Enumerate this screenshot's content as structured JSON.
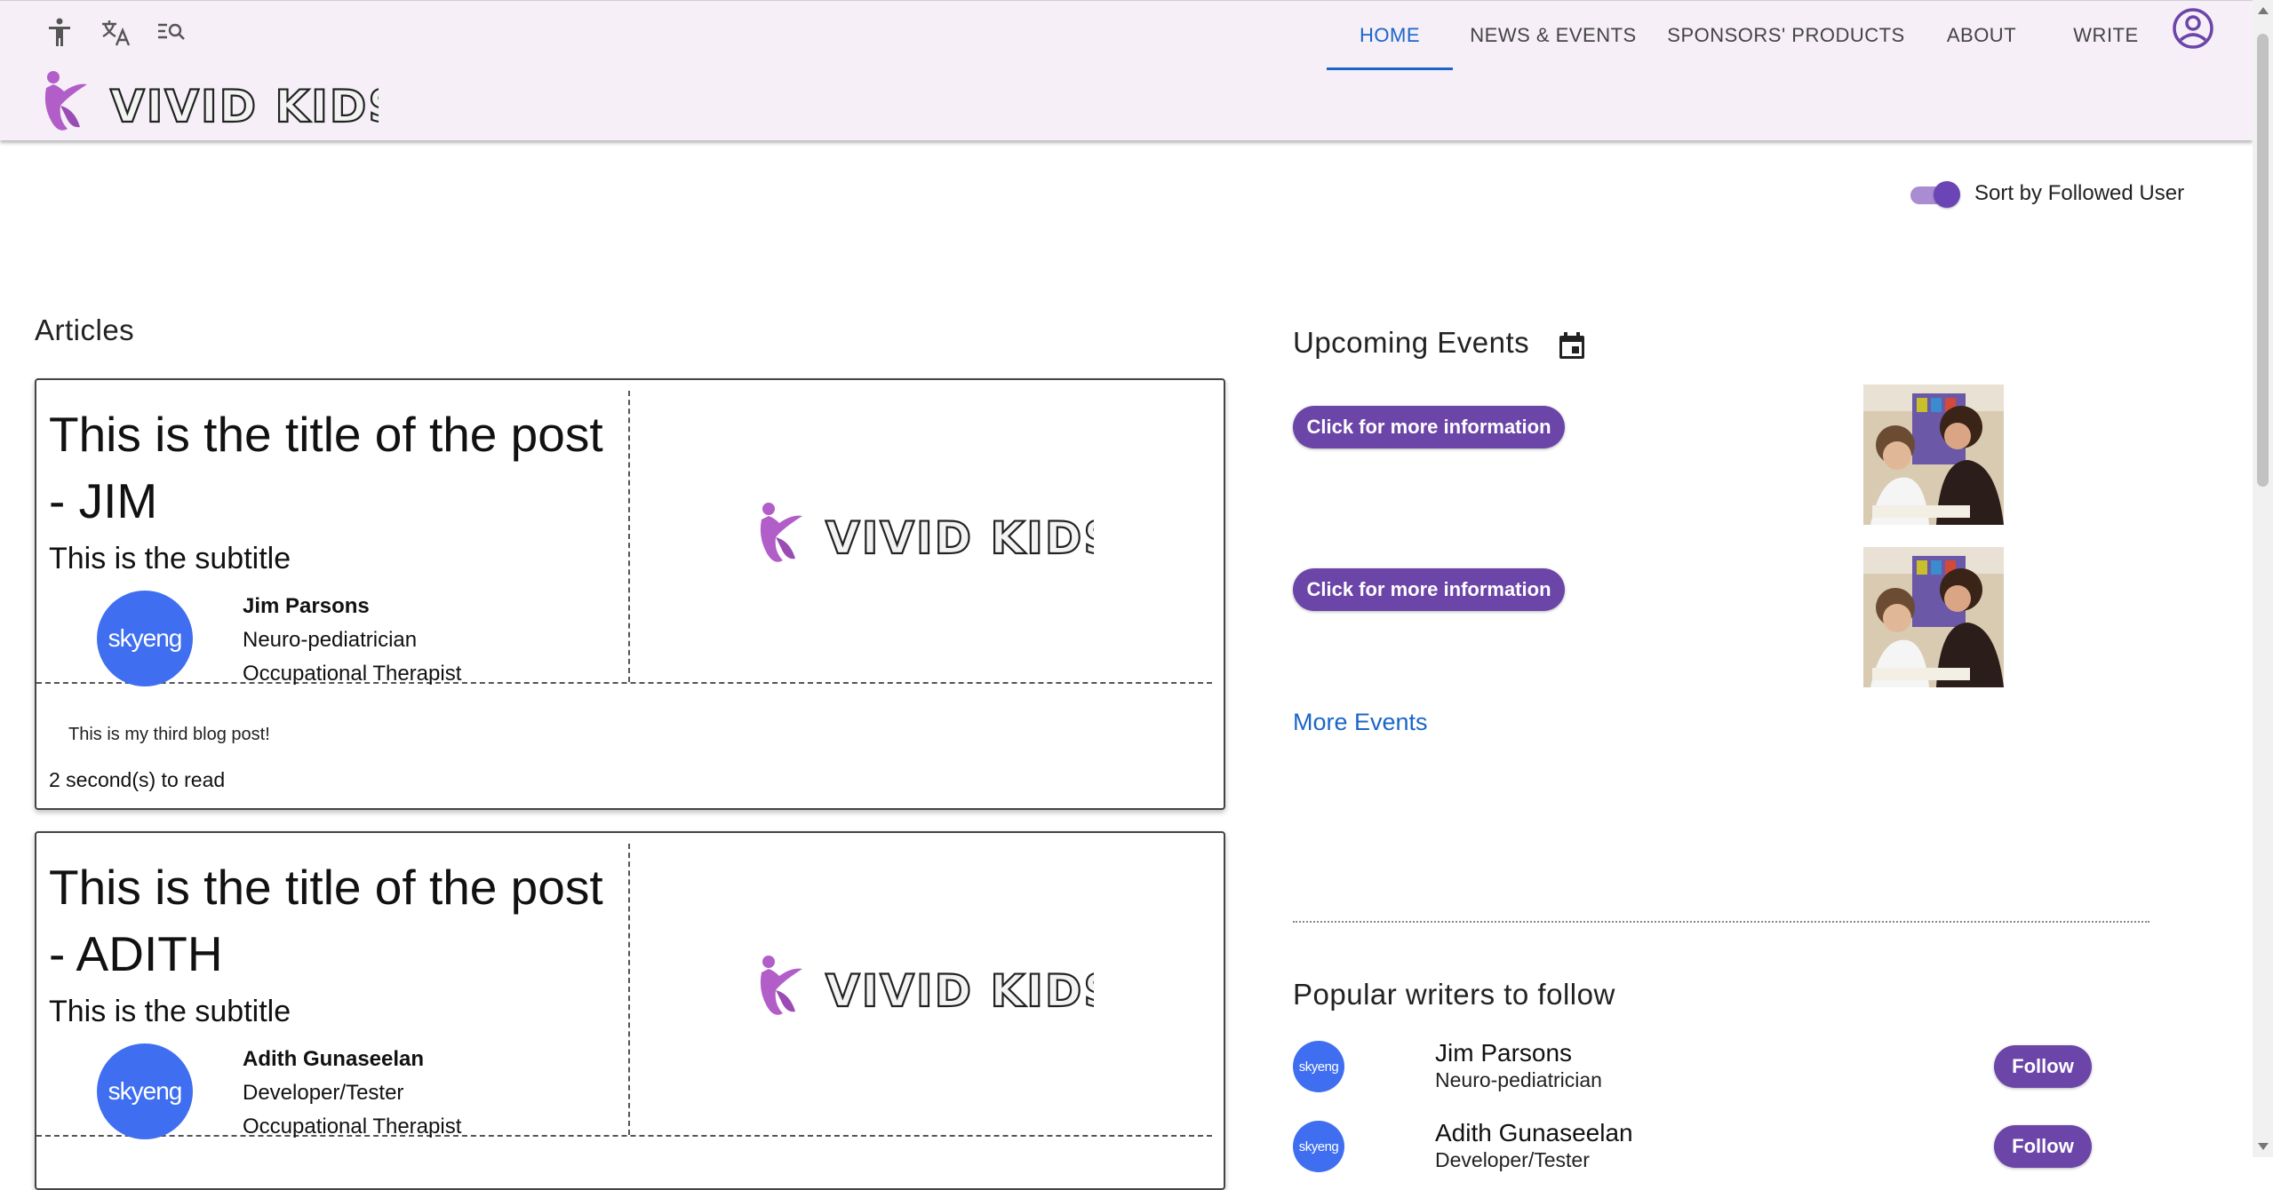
{
  "header": {
    "brand": "VIVID KIDS",
    "nav": [
      {
        "label": "HOME",
        "active": true
      },
      {
        "label": "NEWS & EVENTS",
        "active": false
      },
      {
        "label": "SPONSORS' PRODUCTS",
        "active": false
      },
      {
        "label": "ABOUT",
        "active": false
      },
      {
        "label": "WRITE",
        "active": false
      }
    ],
    "tools": [
      "accessibility-icon",
      "translate-icon",
      "search-list-icon"
    ],
    "account_icon": "account-circle-icon",
    "accent_color": "#1a66c8"
  },
  "sort": {
    "label": "Sort by Followed User",
    "enabled": true
  },
  "articles": {
    "heading": "Articles",
    "items": [
      {
        "title": "This is the title of the post - JIM",
        "subtitle": "This is the subtitle",
        "author": "Jim Parsons",
        "role": "Neuro-pediatrician",
        "specialty": "Occupational Therapist",
        "avatar_text": "skyeng",
        "body": "This is my third blog post!",
        "read_time": "2 second(s) to read"
      },
      {
        "title": "This is the title of the post - ADITH",
        "subtitle": "This is the subtitle",
        "author": "Adith Gunaseelan",
        "role": "Developer/Tester",
        "specialty": "Occupational Therapist",
        "avatar_text": "skyeng"
      }
    ]
  },
  "events": {
    "heading": "Upcoming Events",
    "items": [
      {
        "button_label": "Click for more information"
      },
      {
        "button_label": "Click for more information"
      }
    ],
    "more_link": "More Events"
  },
  "writers": {
    "heading": "Popular writers to follow",
    "items": [
      {
        "name": "Jim Parsons",
        "role": "Neuro-pediatrician",
        "avatar_text": "skyeng",
        "button_label": "Follow"
      },
      {
        "name": "Adith Gunaseelan",
        "role": "Developer/Tester",
        "avatar_text": "skyeng",
        "button_label": "Follow"
      }
    ]
  },
  "colors": {
    "primary": "#6b45a8",
    "header_bg": "#f6eff8",
    "avatar": "#3f6ff0",
    "link": "#1a66c8"
  }
}
